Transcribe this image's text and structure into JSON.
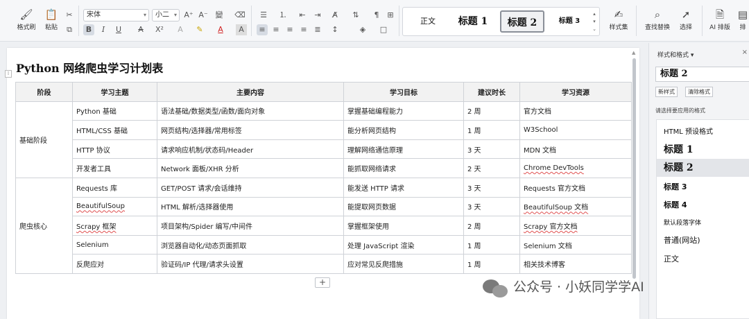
{
  "ribbon": {
    "format_painter": "格式刷",
    "paste": "粘贴",
    "font_name": "宋体",
    "font_size": "小二",
    "styles": [
      "正文",
      "标题 1",
      "标题 2",
      "标题 3"
    ],
    "style_set": "样式集",
    "find_replace": "查找替换",
    "select": "选择",
    "ai_layout": "AI 排版",
    "more": "排"
  },
  "document": {
    "title": "Python 网络爬虫学习计划表",
    "table": {
      "headers": [
        "阶段",
        "学习主题",
        "主要内容",
        "学习目标",
        "建议时长",
        "学习资源"
      ],
      "groups": [
        {
          "stage": "基础阶段",
          "rows": [
            [
              "Python 基础",
              "语法基础/数据类型/函数/面向对象",
              "掌握基础编程能力",
              "2 周",
              "官方文档"
            ],
            [
              "HTML/CSS 基础",
              "网页结构/选择器/常用标签",
              "能分析网页结构",
              "1 周",
              "W3School"
            ],
            [
              "HTTP 协议",
              "请求响应机制/状态码/Header",
              "理解网络通信原理",
              "3 天",
              "MDN 文档"
            ],
            [
              "开发者工具",
              "Network 面板/XHR 分析",
              "能抓取网络请求",
              "2 天",
              "Chrome DevTools"
            ]
          ]
        },
        {
          "stage": "爬虫核心",
          "rows": [
            [
              "Requests 库",
              "GET/POST 请求/会话维持",
              "能发送 HTTP 请求",
              "3 天",
              "Requests 官方文档"
            ],
            [
              "BeautifulSoup",
              "HTML 解析/选择器使用",
              "能提取网页数据",
              "3 天",
              "BeautifulSoup 文档"
            ],
            [
              "Scrapy 框架",
              "项目架构/Spider 编写/中间件",
              "掌握框架使用",
              "2 周",
              "Scrapy 官方文档"
            ],
            [
              "Selenium",
              "浏览器自动化/动态页面抓取",
              "处理 JavaScript 渲染",
              "1 周",
              "Selenium 文档"
            ],
            [
              "反爬应对",
              "验证码/IP 代理/请求头设置",
              "应对常见反爬措施",
              "1 周",
              "相关技术博客"
            ]
          ]
        }
      ]
    },
    "add_row": "+"
  },
  "panel": {
    "title": "样式和格式",
    "current_style": "标题 2",
    "new_style": "新样式",
    "clear_format": "清除格式",
    "hint": "请选择要应用的格式",
    "styles": [
      "HTML 预设格式",
      "标题 1",
      "标题 2",
      "标题 3",
      "标题 4",
      "默认段落字体",
      "普通(网站)",
      "正文"
    ]
  },
  "watermark": "公众号 · 小妖同学学AI"
}
